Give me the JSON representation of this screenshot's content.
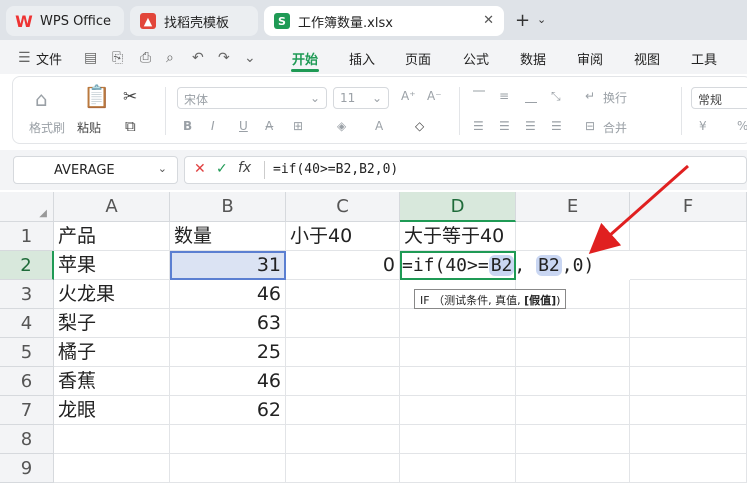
{
  "tabs": [
    {
      "label": "WPS Office",
      "icon": "wps-logo-icon"
    },
    {
      "label": "找稻壳模板",
      "icon": "template-icon"
    },
    {
      "label": "工作簿数量.xlsx",
      "icon": "spreadsheet-icon"
    }
  ],
  "menu": {
    "file": "文件",
    "items": [
      "开始",
      "插入",
      "页面",
      "公式",
      "数据",
      "审阅",
      "视图",
      "工具"
    ],
    "active": "开始"
  },
  "ribbon": {
    "format_painter": "格式刷",
    "paste": "粘贴",
    "font_name": "宋体",
    "font_size": "11",
    "wrap": "换行",
    "merge": "合并",
    "number_format": "常规",
    "currency": "¥",
    "percent": "%"
  },
  "formula_bar": {
    "name_box": "AVERAGE",
    "formula": "=if(40>=B2,B2,0)"
  },
  "columns": [
    "A",
    "B",
    "C",
    "D",
    "E",
    "F"
  ],
  "rows": [
    "1",
    "2",
    "3",
    "4",
    "5",
    "6",
    "7",
    "8",
    "9"
  ],
  "cells": {
    "A1": "产品",
    "B1": "数量",
    "C1": "小于40",
    "D1": "大于等于40",
    "A2": "苹果",
    "B2": "31",
    "C2": "0",
    "A3": "火龙果",
    "B3": "46",
    "A4": "梨子",
    "B4": "63",
    "A5": "橘子",
    "B5": "25",
    "A6": "香蕉",
    "B6": "46",
    "A7": "龙眼",
    "B7": "62"
  },
  "edit_cell": {
    "prefix": "=if(40>=",
    "ref1": "B2",
    "comma": ",",
    "ref2": "B2",
    "suffix": ",0)"
  },
  "tooltip": {
    "func": "IF",
    "args": "（测试条件, 真值,",
    "current_arg": "[假值]",
    "close": ")"
  },
  "colors": {
    "accent": "#1f9a55",
    "arrow": "#e02020",
    "reference": "#c9d6f2"
  }
}
